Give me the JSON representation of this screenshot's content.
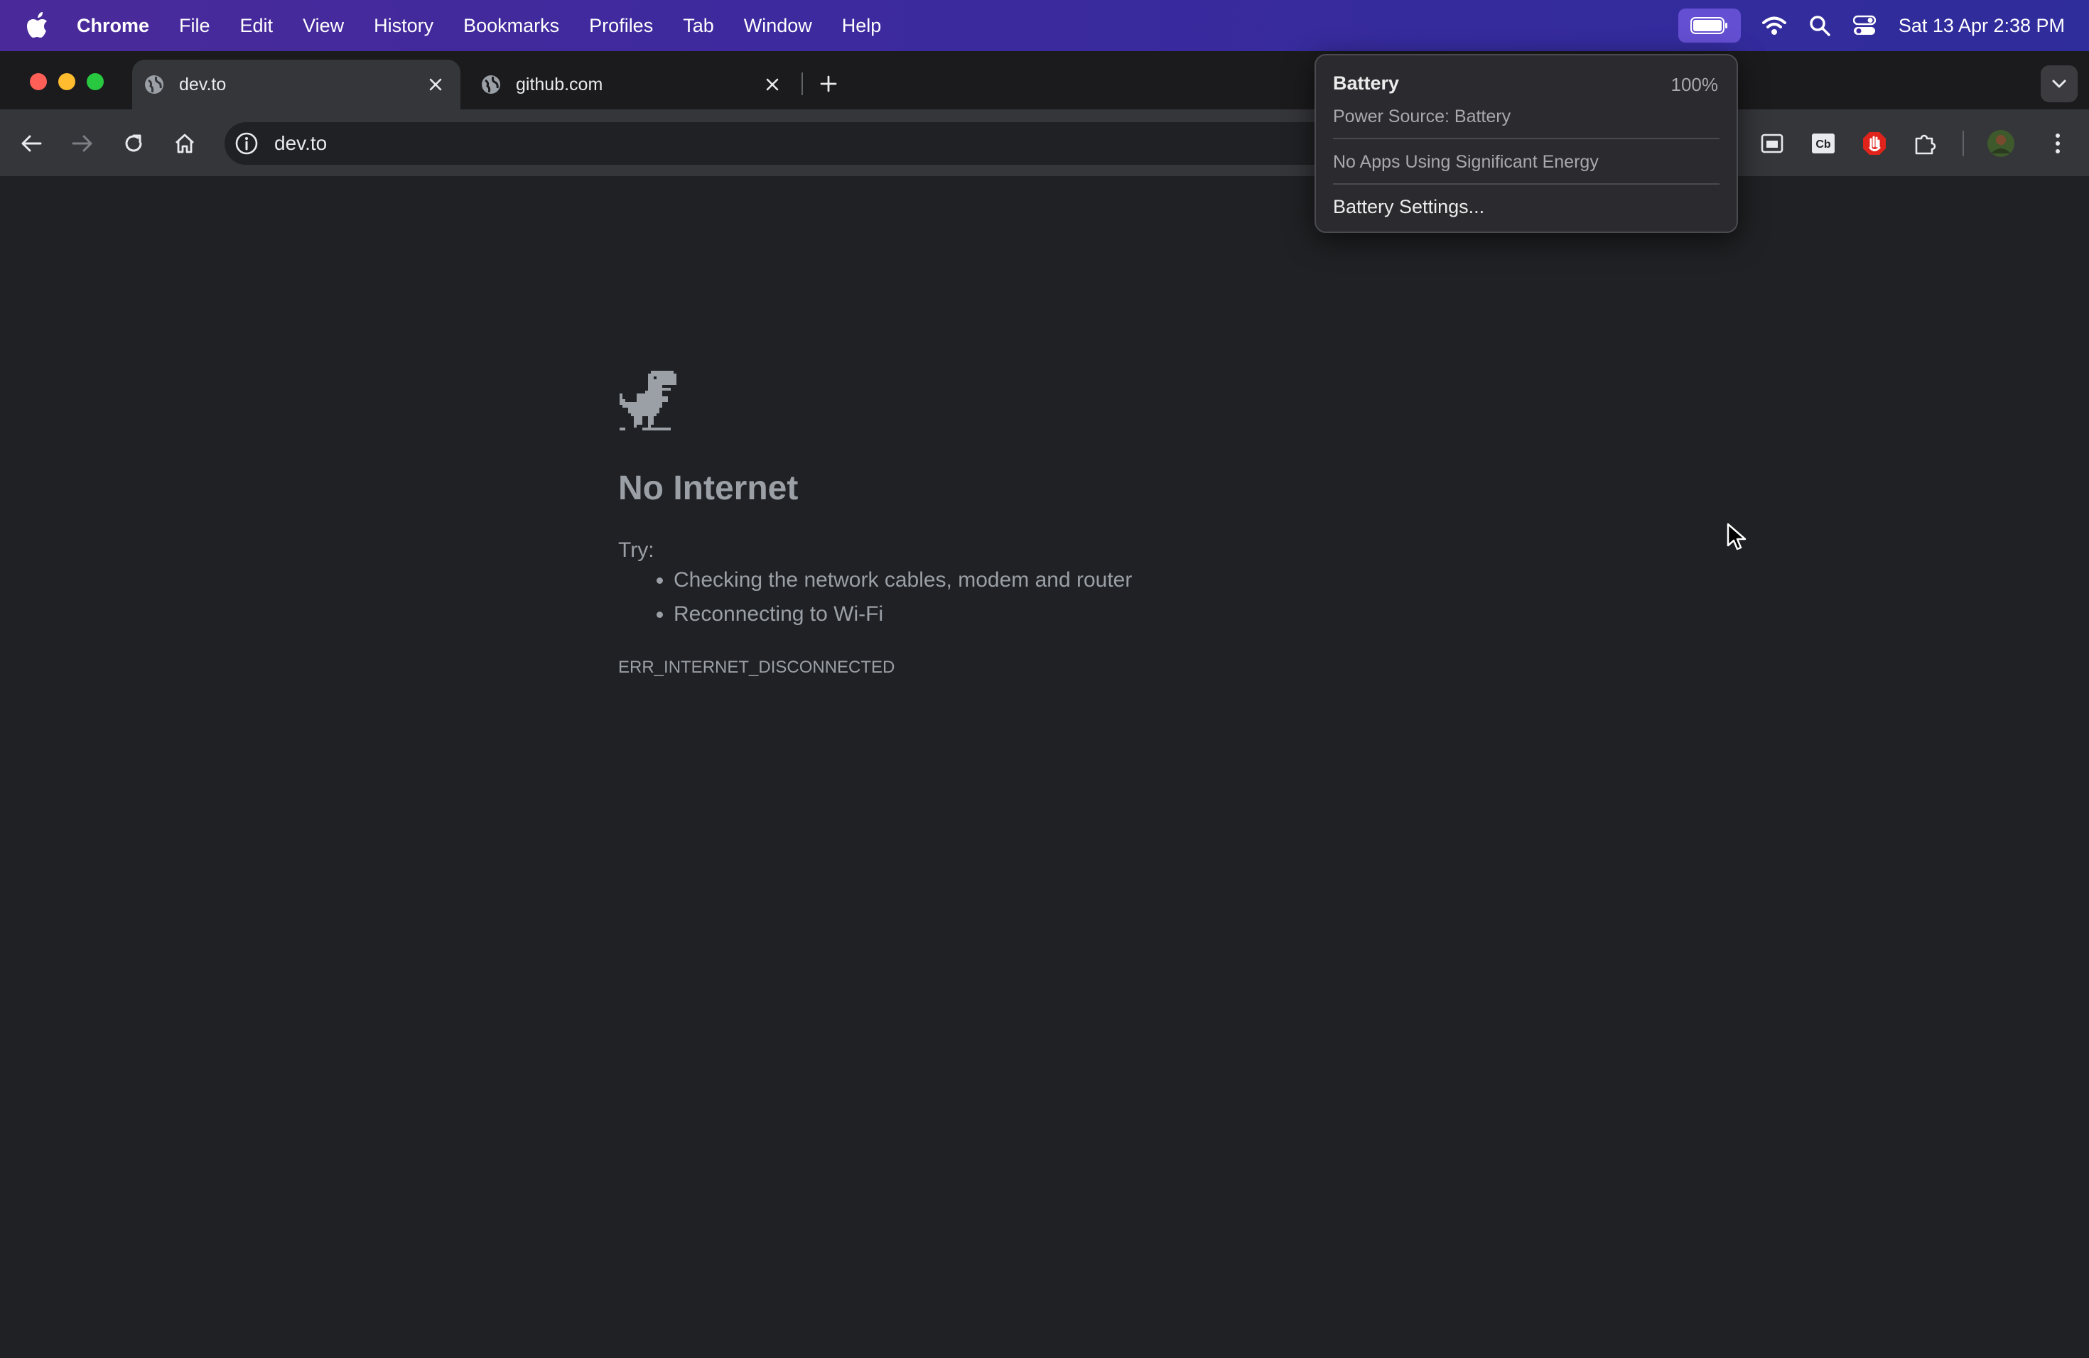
{
  "menubar": {
    "app_name": "Chrome",
    "menus": [
      "File",
      "Edit",
      "View",
      "History",
      "Bookmarks",
      "Profiles",
      "Tab",
      "Window",
      "Help"
    ],
    "clock": "Sat 13 Apr  2:38 PM"
  },
  "tabs": [
    {
      "title": "dev.to",
      "active": true
    },
    {
      "title": "github.com",
      "active": false
    }
  ],
  "omnibox": {
    "url": "dev.to"
  },
  "error_page": {
    "title": "No Internet",
    "try_label": "Try:",
    "suggestions": [
      "Checking the network cables, modem and router",
      "Reconnecting to Wi-Fi"
    ],
    "error_code": "ERR_INTERNET_DISCONNECTED"
  },
  "battery_menu": {
    "title": "Battery",
    "percent": "100%",
    "power_source": "Power Source: Battery",
    "apps_note": "No Apps Using Significant Energy",
    "settings_label": "Battery Settings..."
  },
  "colors": {
    "menubar_accent": "#3c2a9e",
    "page_background": "#202124",
    "toolbar": "#35363a",
    "close_red": "#ff5f57",
    "minimize_yellow": "#febc2e",
    "zoom_green": "#28c840"
  },
  "icons": [
    "apple-logo-icon",
    "battery-icon",
    "wifi-icon",
    "spotlight-search-icon",
    "control-center-icon",
    "globe-icon",
    "close-icon",
    "plus-icon",
    "chevron-down-icon",
    "back-arrow-icon",
    "forward-arrow-icon",
    "reload-icon",
    "home-icon",
    "info-icon",
    "cast-icon",
    "cb-extension-icon",
    "adblock-hand-icon",
    "extensions-puzzle-icon",
    "profile-avatar",
    "kebab-menu-icon",
    "dinosaur-icon",
    "mouse-pointer-icon"
  ]
}
